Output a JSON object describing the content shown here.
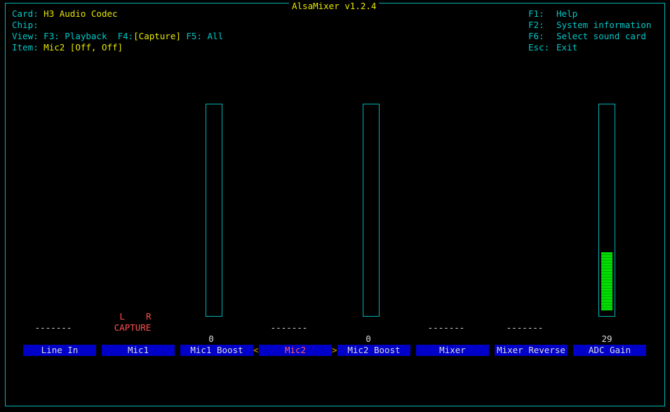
{
  "window": {
    "title": "AlsaMixer v1.2.4"
  },
  "info": {
    "card_label": "Card:",
    "card_value": "H3 Audio Codec",
    "chip_label": "Chip:",
    "chip_value": "",
    "view_label": "View:",
    "view_f3": "F3:",
    "view_playback": "Playback",
    "view_f4": "F4:",
    "view_capture": "[Capture]",
    "view_f5": "F5:",
    "view_all": "All",
    "item_label": "Item:",
    "item_value": "Mic2 [Off, Off]"
  },
  "help": [
    {
      "key": "F1:",
      "text": "Help"
    },
    {
      "key": "F2:",
      "text": "System information"
    },
    {
      "key": "F6:",
      "text": "Select sound card"
    },
    {
      "key": "Esc:",
      "text": "Exit"
    }
  ],
  "controls": [
    {
      "name": "Line In",
      "status": "-------"
    },
    {
      "name": "Mic1",
      "lr": "L    R",
      "status": "CAPTURE"
    },
    {
      "name": "Mic1 Boost",
      "value": "0",
      "level": 0
    },
    {
      "name": "Mic2",
      "status": "-------",
      "selected": true
    },
    {
      "name": "Mic2 Boost",
      "value": "0",
      "level": 0
    },
    {
      "name": "Mixer",
      "status": "-------"
    },
    {
      "name": "Mixer Reverse",
      "status": "-------"
    },
    {
      "name": "ADC Gain",
      "value": "29",
      "level": 0.29
    }
  ],
  "selection_markers": {
    "left": "<",
    "right": ">"
  },
  "colors": {
    "background": "#000000",
    "frame": "#00b4b4",
    "title": "#e6e600",
    "name_bg": "#0000c8",
    "bar": "#00e000",
    "capture": "#ff5050"
  }
}
